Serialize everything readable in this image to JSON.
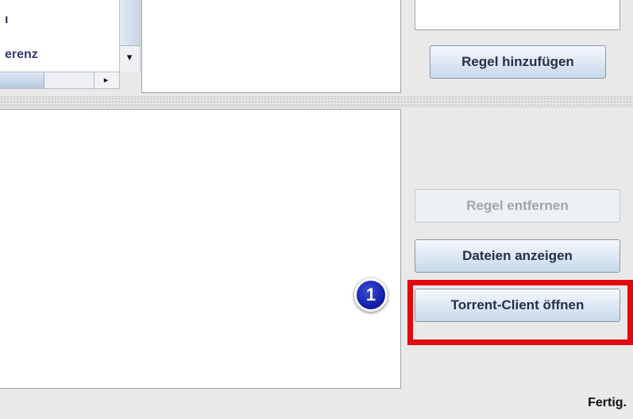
{
  "left_list": {
    "row1_text": "ı",
    "row2_text": "erenz",
    "scroll_down_arrow": "▾",
    "scroll_right_arrow": "▸"
  },
  "buttons": {
    "add_rule": "Regel hinzufügen",
    "remove_rule": "Regel entfernen",
    "show_files": "Dateien anzeigen",
    "open_client": "Torrent-Client öffnen"
  },
  "annotation": {
    "badge_number": "1",
    "highlight_color": "#e3080f"
  },
  "status_bar": {
    "text": "Fertig."
  }
}
